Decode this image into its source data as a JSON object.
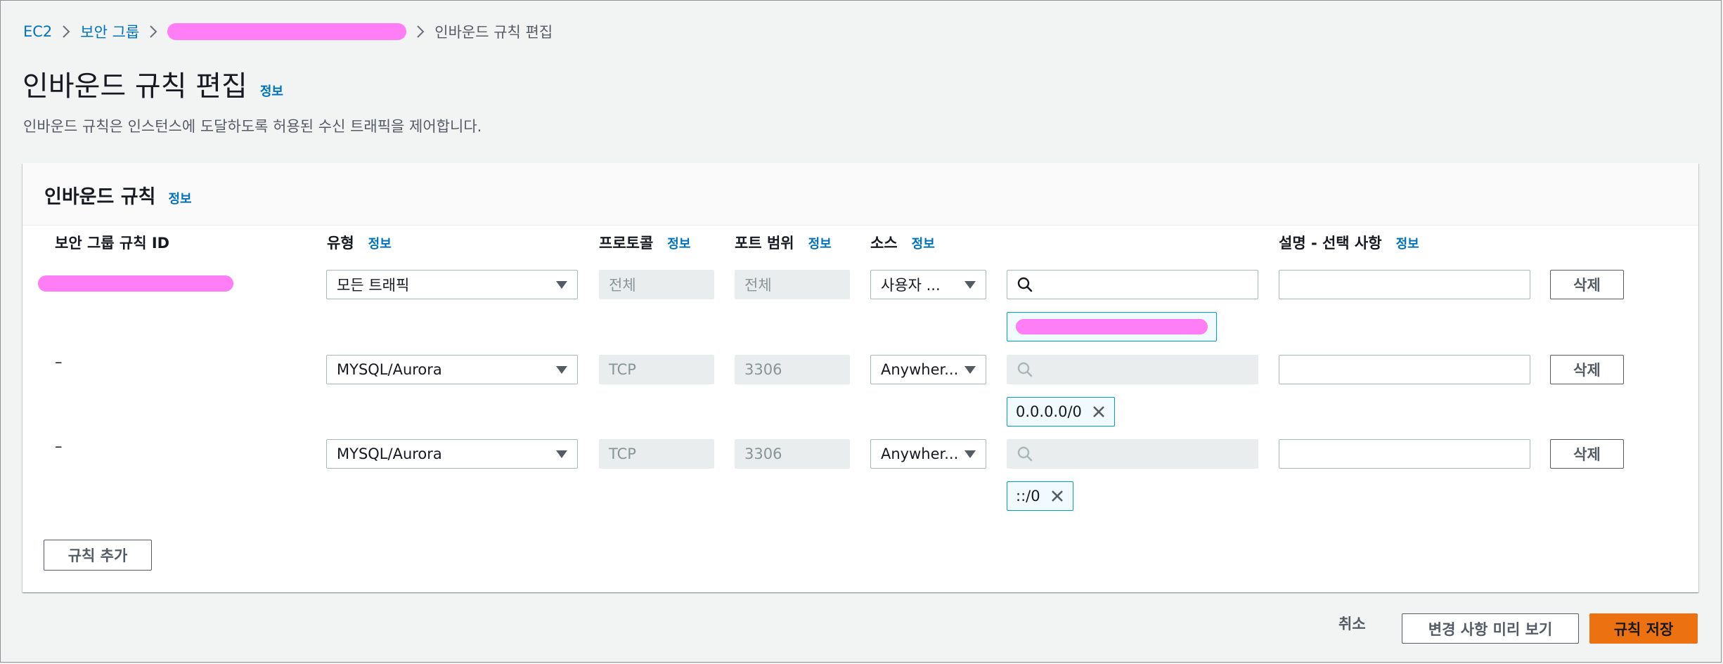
{
  "breadcrumb": {
    "items": [
      "EC2",
      "보안 그룹"
    ],
    "current": "인바운드 규칙 편집"
  },
  "page": {
    "title": "인바운드 규칙 편집",
    "info": "정보",
    "description": "인바운드 규칙은 인스턴스에 도달하도록 허용된 수신 트래픽을 제어합니다."
  },
  "panel": {
    "title": "인바운드 규칙",
    "info": "정보",
    "columns": {
      "rule_id": "보안 그룹 규칙 ID",
      "type": "유형",
      "protocol": "프로토콜",
      "port_range": "포트 범위",
      "source": "소스",
      "description": "설명 - 선택 사항"
    },
    "rows": [
      {
        "rule_id": "",
        "type": "모든 트래픽",
        "protocol": "전체",
        "port_range": "전체",
        "source": "사용자 ...",
        "source_value": "",
        "token": "",
        "delete": "삭제"
      },
      {
        "rule_id": "–",
        "type": "MYSQL/Aurora",
        "protocol": "TCP",
        "port_range": "3306",
        "source": "Anywher...",
        "source_value": "",
        "token": "0.0.0.0/0",
        "delete": "삭제"
      },
      {
        "rule_id": "–",
        "type": "MYSQL/Aurora",
        "protocol": "TCP",
        "port_range": "3306",
        "source": "Anywher...",
        "source_value": "",
        "token": "::/0",
        "delete": "삭제"
      }
    ],
    "add_rule": "규칙 추가"
  },
  "footer": {
    "cancel": "취소",
    "preview": "변경 사항 미리 보기",
    "save": "규칙 저장"
  },
  "colors": {
    "link": "#0073bb",
    "primary": "#ec7211",
    "background": "#f2f3f3",
    "token_border": "#00a1c9"
  },
  "icons": [
    "chevron-right-icon",
    "search-icon",
    "caret-down-icon",
    "close-icon"
  ]
}
